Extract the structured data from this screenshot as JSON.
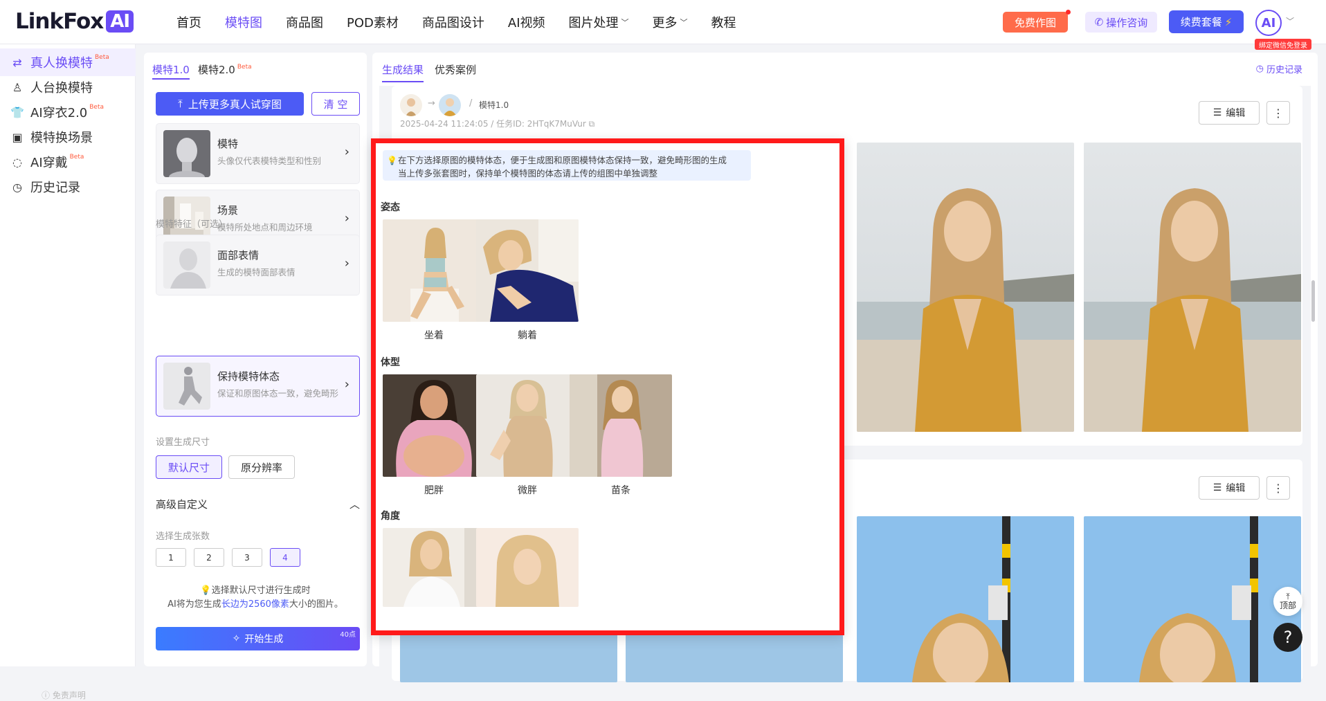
{
  "brand": {
    "logo_text": "LinkFox",
    "logo_badge": "AI",
    "accent": "#6a4cf5",
    "primary": "#4c5bf5",
    "orange": "#ff6b4a",
    "highlight": "#ff1a1a"
  },
  "nav": {
    "items": [
      {
        "label": "首页",
        "active": false,
        "dropdown": false
      },
      {
        "label": "模特图",
        "active": true,
        "dropdown": false
      },
      {
        "label": "商品图",
        "active": false,
        "dropdown": false
      },
      {
        "label": "POD素材",
        "active": false,
        "dropdown": false
      },
      {
        "label": "商品图设计",
        "active": false,
        "dropdown": false
      },
      {
        "label": "AI视频",
        "active": false,
        "dropdown": false
      },
      {
        "label": "图片处理",
        "active": false,
        "dropdown": true
      },
      {
        "label": "更多",
        "active": false,
        "dropdown": true
      },
      {
        "label": "教程",
        "active": false,
        "dropdown": false
      }
    ]
  },
  "header": {
    "free_label": "免费作图",
    "consult_label": "操作咨询",
    "renew_label": "续费套餐",
    "avatar_text": "AI",
    "bind_tag": "绑定微信免登录"
  },
  "sidebar": {
    "items": [
      {
        "label": "真人换模特",
        "beta": "Beta",
        "active": true,
        "icon": "model-swap-icon"
      },
      {
        "label": "人台换模特",
        "beta": "",
        "active": false,
        "icon": "mannequin-icon"
      },
      {
        "label": "AI穿衣2.0",
        "beta": "Beta",
        "active": false,
        "icon": "shirt-icon"
      },
      {
        "label": "模特换场景",
        "beta": "",
        "active": false,
        "icon": "scene-icon"
      },
      {
        "label": "AI穿戴",
        "beta": "Beta",
        "active": false,
        "icon": "accessory-icon"
      },
      {
        "label": "历史记录",
        "beta": "",
        "active": false,
        "icon": "history-icon"
      }
    ],
    "disclaimer": "免责声明"
  },
  "config": {
    "tabs": [
      {
        "label": "模特1.0",
        "beta": "",
        "active": true
      },
      {
        "label": "模特2.0",
        "beta": "Beta",
        "active": false
      }
    ],
    "upload_label": "上传更多真人试穿图",
    "clear_label": "清 空",
    "cards": [
      {
        "title": "模特",
        "sub": "头像仅代表模特类型和性别"
      },
      {
        "title": "场景",
        "sub": "模特所处地点和周边环境"
      },
      {
        "title": "面部表情",
        "sub": "生成的模特面部表情"
      },
      {
        "title": "保持模特体态",
        "sub": "保证和原图体态一致，避免畸形"
      }
    ],
    "feature_label": "模特特征（可选）",
    "size_label": "设置生成尺寸",
    "size_options": [
      {
        "label": "默认尺寸",
        "active": true
      },
      {
        "label": "原分辨率",
        "active": false
      }
    ],
    "advanced_label": "高级自定义",
    "count_label": "选择生成张数",
    "count_options": [
      {
        "label": "1",
        "active": false
      },
      {
        "label": "2",
        "active": false
      },
      {
        "label": "3",
        "active": false
      },
      {
        "label": "4",
        "active": true
      }
    ],
    "hint_line1": "选择默认尺寸进行生成时",
    "hint_line2_pre": "AI将为您生成",
    "hint_line2_hl": "长边为2560像素",
    "hint_line2_post": "大小的图片。",
    "generate_label": "开始生成",
    "generate_cost": "40点"
  },
  "main": {
    "tabs": [
      {
        "label": "生成结果",
        "active": true
      },
      {
        "label": "优秀案例",
        "active": false
      }
    ],
    "history_label": "历史记录",
    "result": {
      "model_version": "模特1.0",
      "meta": "2025-04-24 11:24:05 / 任务ID: 2HTqK7MuVur",
      "edit_label": "编辑"
    }
  },
  "popup": {
    "tip_line1": "在下方选择原图的模特体态，便于生成图和原图模特体态保持一致，避免畸形图的生成",
    "tip_line2": "当上传多张套图时，保持单个模特图的体态请上传的组图中单独调整",
    "sections": [
      {
        "title": "姿态",
        "options": [
          "坐着",
          "躺着"
        ]
      },
      {
        "title": "体型",
        "options": [
          "肥胖",
          "微胖",
          "苗条"
        ]
      },
      {
        "title": "角度",
        "options": [
          "",
          ""
        ]
      }
    ]
  },
  "floating": {
    "top_label": "顶部",
    "help_label": "?"
  }
}
